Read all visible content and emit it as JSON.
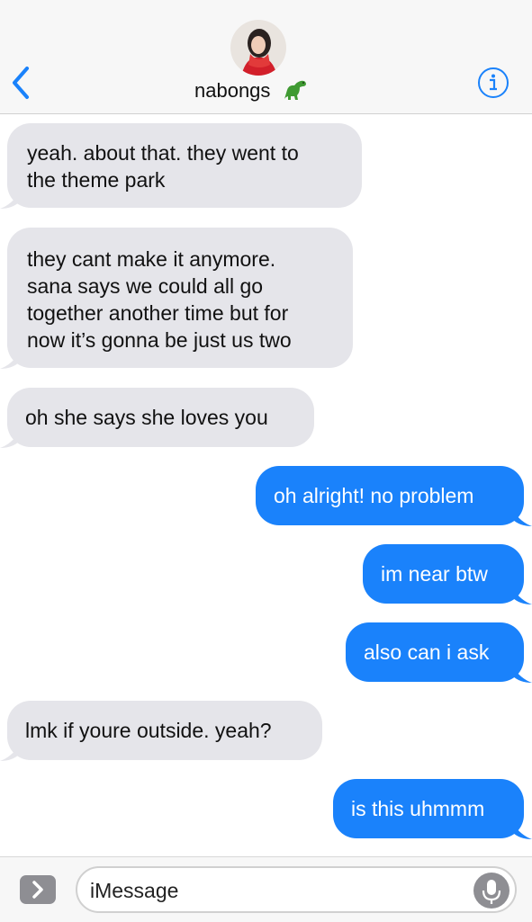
{
  "header": {
    "contact_name": "nabongs",
    "back_icon": "chevron-left-icon",
    "info_icon": "info-icon",
    "emoji": "dinosaur",
    "accent_color": "#1a82fb"
  },
  "messages": [
    {
      "direction": "incoming",
      "text": "yeah. about that. they went to\nthe theme park"
    },
    {
      "direction": "incoming",
      "text": "they cant make it anymore.\nsana says we could all go\ntogether another time but for\nnow it’s gonna be just us two"
    },
    {
      "direction": "incoming",
      "text": "oh she says she loves you"
    },
    {
      "direction": "outgoing",
      "text": "oh alright! no problem"
    },
    {
      "direction": "outgoing",
      "text": "im near btw"
    },
    {
      "direction": "outgoing",
      "text": "also can i ask"
    },
    {
      "direction": "incoming",
      "text": "lmk if youre outside. yeah?"
    },
    {
      "direction": "outgoing",
      "text": "is this uhmmm"
    }
  ],
  "colors": {
    "incoming_bubble": "#e5e5ea",
    "outgoing_bubble": "#1a82fb"
  },
  "composer": {
    "placeholder": "iMessage",
    "apps_icon": "chevron-right-icon",
    "mic_icon": "microphone-icon"
  }
}
